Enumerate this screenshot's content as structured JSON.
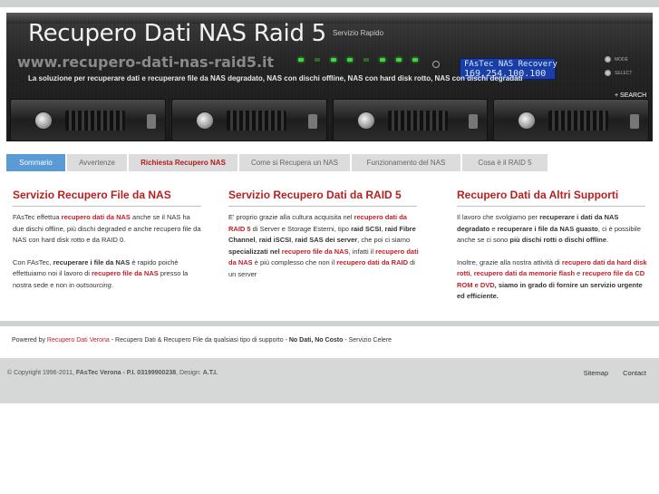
{
  "header": {
    "title": "Recupero Dati NAS Raid 5",
    "tagline": "Servizio Rapido",
    "url": "www.recupero-dati-nas-raid5.it",
    "description": "La soluzione per recuperare dati e recuperare file da NAS degradato, NAS con dischi offline, NAS con hard disk rotto, NAS con dischi degradati",
    "lcd_line1": "FAsTec NAS Recovery",
    "lcd_line2": "169.254.100.100",
    "hw_button_1": "MODE",
    "hw_button_2": "SELECT",
    "search_label": "+ SEARCH"
  },
  "nav": [
    {
      "label": "Sommario",
      "state": "active"
    },
    {
      "label": "Avvertenze",
      "state": "normal"
    },
    {
      "label": "Richiesta Recupero NAS",
      "state": "highlight"
    },
    {
      "label": "Come si Recupera un NAS",
      "state": "normal"
    },
    {
      "label": "Funzionamento del NAS",
      "state": "normal"
    },
    {
      "label": "Cosa è il RAID 5",
      "state": "normal"
    }
  ],
  "columns": [
    {
      "heading": "Servizio Recupero File da NAS",
      "p1": [
        {
          "t": "FAsTec effettua ",
          "s": "n"
        },
        {
          "t": "recupero dati da NAS",
          "s": "r"
        },
        {
          "t": " anche se il NAS ha due dischi offline, più dischi degraded e anche recupero file da NAS con hard disk rotto e da RAID 0.",
          "s": "n"
        }
      ],
      "p2": [
        {
          "t": "Con FAsTec, ",
          "s": "n"
        },
        {
          "t": "recuperare i file da NAS",
          "s": "b"
        },
        {
          "t": " è rapido poichè effettuiamo noi il lavoro di ",
          "s": "n"
        },
        {
          "t": "recupero file da NAS",
          "s": "r"
        },
        {
          "t": " presso la nostra sede e non in ",
          "s": "n"
        },
        {
          "t": "outsourcing",
          "s": "i"
        },
        {
          "t": ".",
          "s": "n"
        }
      ]
    },
    {
      "heading": "Servizio Recupero Dati da RAID 5",
      "p1": [
        {
          "t": "E' proprio grazie alla cultura acquisita nel ",
          "s": "n"
        },
        {
          "t": "recupero dati da RAID 5",
          "s": "r"
        },
        {
          "t": " di Server e Storage Esterni, tipo ",
          "s": "n"
        },
        {
          "t": "raid SCSI",
          "s": "b"
        },
        {
          "t": ", ",
          "s": "n"
        },
        {
          "t": "raid Fibre Channel",
          "s": "b"
        },
        {
          "t": ", ",
          "s": "n"
        },
        {
          "t": "raid iSCSI",
          "s": "b"
        },
        {
          "t": ", ",
          "s": "n"
        },
        {
          "t": "raid SAS dei server",
          "s": "b"
        },
        {
          "t": ", che poi ci siamo ",
          "s": "n"
        },
        {
          "t": "specializzati nel",
          "s": "b"
        },
        {
          "t": " ",
          "s": "n"
        },
        {
          "t": "recupero file da NAS",
          "s": "r"
        },
        {
          "t": ", infatti il ",
          "s": "n"
        },
        {
          "t": "recupero dati da NAS",
          "s": "r"
        },
        {
          "t": " è più complesso che non il ",
          "s": "n"
        },
        {
          "t": "recupero dati da RAID",
          "s": "r"
        },
        {
          "t": " di un server",
          "s": "n"
        }
      ],
      "p2": []
    },
    {
      "heading": "Recupero Dati da Altri Supporti",
      "p1": [
        {
          "t": "Il lavoro che svolgiamo per ",
          "s": "n"
        },
        {
          "t": "recuperare i dati da NAS degradato",
          "s": "b"
        },
        {
          "t": " e ",
          "s": "n"
        },
        {
          "t": "recuperare i file da NAS guasto",
          "s": "b"
        },
        {
          "t": ", ci è possibile anche se ci sono ",
          "s": "n"
        },
        {
          "t": "più dischi rotti o dischi offline",
          "s": "b"
        },
        {
          "t": ".",
          "s": "n"
        }
      ],
      "p2": [
        {
          "t": "Inoltre, grazie alla nostra attività di ",
          "s": "n"
        },
        {
          "t": "recupero dati da hard disk rotti",
          "s": "r"
        },
        {
          "t": ", ",
          "s": "n"
        },
        {
          "t": "recupero dati da memorie flash",
          "s": "r"
        },
        {
          "t": " e ",
          "s": "n"
        },
        {
          "t": "recupero file da CD ROM e DVD",
          "s": "r"
        },
        {
          "t": ", siamo in grado di fornire un servizio urgente ed efficiente.",
          "s": "b"
        }
      ]
    }
  ],
  "powered": [
    {
      "t": "Powered by ",
      "s": "n"
    },
    {
      "t": "Recupero Dati Verona",
      "s": "r"
    },
    {
      "t": " - Recupero Dati & Recupero File da qualsiasi tipo di supporto - ",
      "s": "n"
    },
    {
      "t": "No Dati, No Costo",
      "s": "b"
    },
    {
      "t": " - Servizio Celere",
      "s": "n"
    }
  ],
  "footer": {
    "copyright": [
      {
        "t": "© Copyright 1996-2011, ",
        "s": "n"
      },
      {
        "t": "FAsTec Verona - P.I. 03199900238",
        "s": "b"
      },
      {
        "t": ", Design: ",
        "s": "n"
      },
      {
        "t": "A.T.I.",
        "s": "b"
      }
    ],
    "sitemap": "Sitemap",
    "contact": "Contact"
  },
  "colors": {
    "accent_red": "#b72020",
    "nav_active": "#5b9bd5",
    "nav_bg": "#dcdcdc",
    "lcd_blue": "#1a3ea8"
  }
}
